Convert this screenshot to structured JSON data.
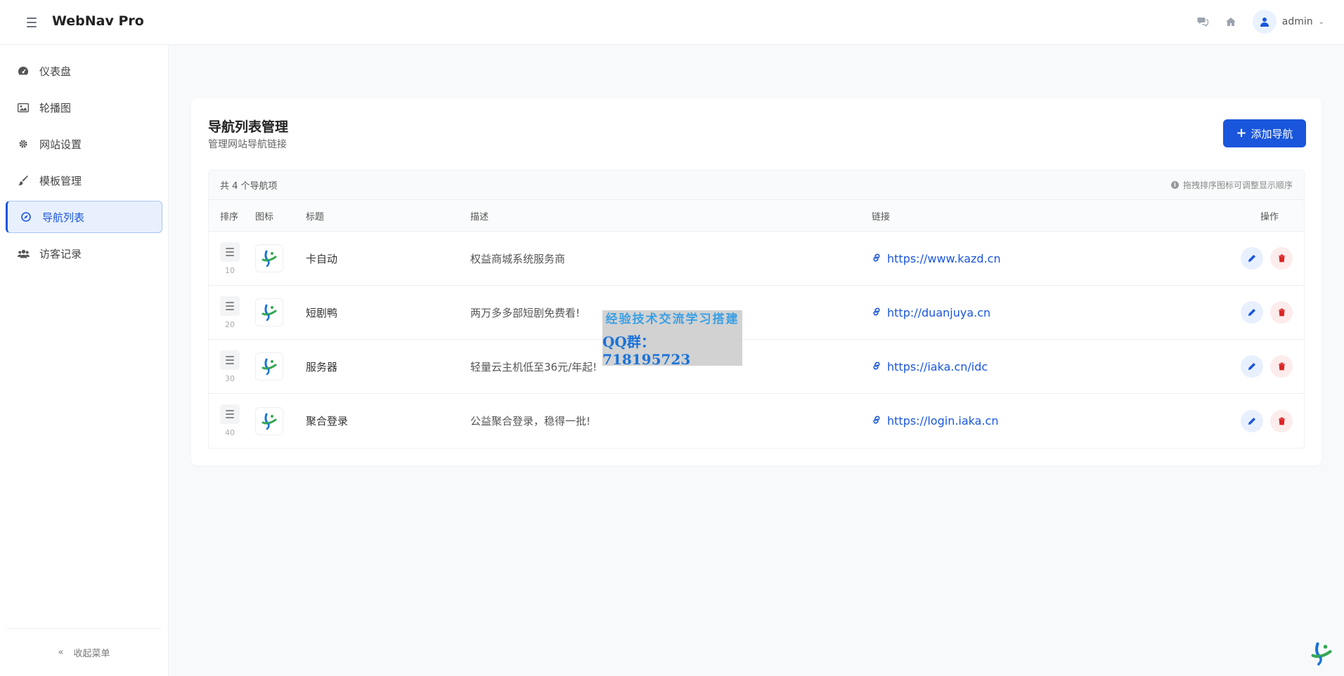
{
  "app": {
    "title": "WebNav Pro"
  },
  "header": {
    "user": "admin"
  },
  "sidebar": {
    "items": [
      {
        "label": "仪表盘",
        "icon": "dashboard-icon"
      },
      {
        "label": "轮播图",
        "icon": "image-icon"
      },
      {
        "label": "网站设置",
        "icon": "gear-icon"
      },
      {
        "label": "模板管理",
        "icon": "brush-icon"
      },
      {
        "label": "导航列表",
        "icon": "compass-icon",
        "active": true
      },
      {
        "label": "访客记录",
        "icon": "users-icon"
      }
    ],
    "collapse_label": "收起菜单"
  },
  "main": {
    "title": "导航列表管理",
    "subtitle": "管理网站导航链接",
    "add_button": "添加导航",
    "total": "共 4 个导航项",
    "hint": "拖拽排序图标可调整显示顺序",
    "columns": [
      "排序",
      "图标",
      "标题",
      "描述",
      "链接",
      "操作"
    ],
    "rows": [
      {
        "sort": "10",
        "title": "卡自动",
        "desc": "权益商城系统服务商",
        "link": "https://www.kazd.cn"
      },
      {
        "sort": "20",
        "title": "短剧鸭",
        "desc": "两万多多部短剧免费看!",
        "link": "http://duanjuya.cn"
      },
      {
        "sort": "30",
        "title": "服务器",
        "desc": "轻量云主机低至36元/年起!",
        "link": "https://iaka.cn/idc"
      },
      {
        "sort": "40",
        "title": "聚合登录",
        "desc": "公益聚合登录，稳得一批!",
        "link": "https://login.iaka.cn"
      }
    ]
  },
  "watermark": {
    "line1": "经验技术交流学习搭建",
    "line2": "QQ群：718195723"
  },
  "colors": {
    "primary": "#1a56db",
    "danger": "#dc2626",
    "bg": "#f8f9fb"
  }
}
